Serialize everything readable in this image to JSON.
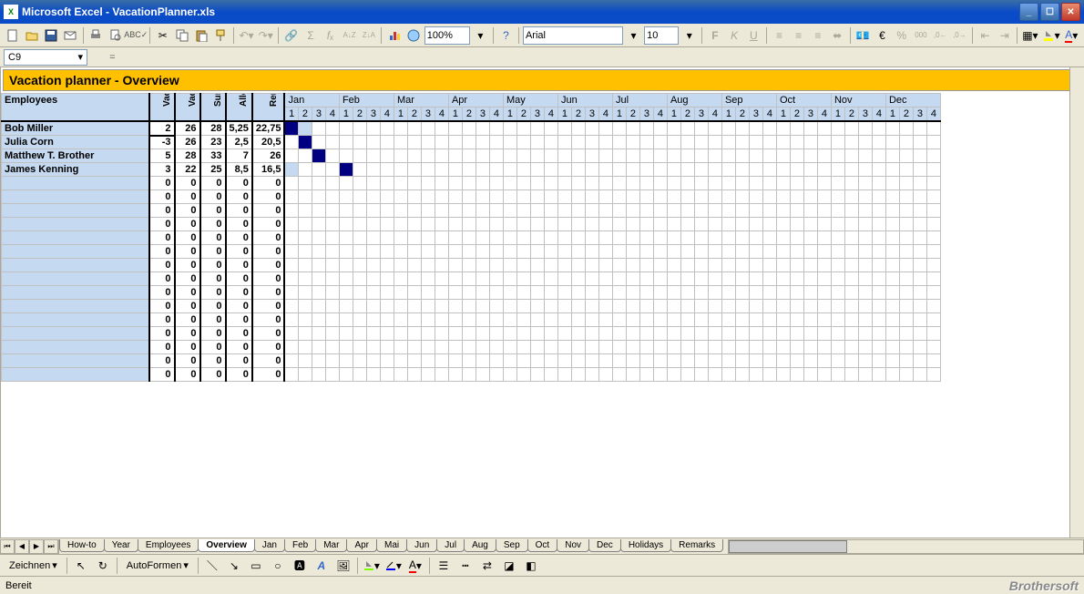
{
  "window": {
    "title": "Microsoft Excel - VacationPlanner.xls"
  },
  "toolbar": {
    "font": "Arial",
    "fontsize": "10",
    "zoom": "100%",
    "bold": "F",
    "italic": "K",
    "underline": "U"
  },
  "formulabar": {
    "namebox": "C9",
    "fx": "="
  },
  "sheet": {
    "title": "Vacation planner - Overview",
    "employees_header": "Employees",
    "col_headers": [
      "Vacation allocation from prior year",
      "Vacation allocation current year",
      "Sum current year",
      "Allocated vacation",
      "Remaing allocation"
    ],
    "months": [
      "Jan",
      "Feb",
      "Mar",
      "Apr",
      "May",
      "Jun",
      "Jul",
      "Aug",
      "Sep",
      "Oct",
      "Nov",
      "Dec"
    ],
    "weeks": [
      "1",
      "2",
      "3",
      "4"
    ],
    "rows": [
      {
        "name": "Bob Miller",
        "v": [
          "2",
          "26",
          "28",
          "5,25",
          "22,75"
        ],
        "cal": {
          "1": "dark",
          "2": "light"
        }
      },
      {
        "name": "Julia Corn",
        "v": [
          "-3",
          "26",
          "23",
          "2,5",
          "20,5"
        ],
        "cal": {
          "2": "dark"
        }
      },
      {
        "name": "Matthew T. Brother",
        "v": [
          "5",
          "28",
          "33",
          "7",
          "26"
        ],
        "cal": {
          "3": "dark"
        }
      },
      {
        "name": "James Kenning",
        "v": [
          "3",
          "22",
          "25",
          "8,5",
          "16,5"
        ],
        "cal": {
          "1": "light",
          "5": "dark"
        }
      },
      {
        "name": "",
        "v": [
          "0",
          "0",
          "0",
          "0",
          "0"
        ]
      },
      {
        "name": "",
        "v": [
          "0",
          "0",
          "0",
          "0",
          "0"
        ]
      },
      {
        "name": "",
        "v": [
          "0",
          "0",
          "0",
          "0",
          "0"
        ]
      },
      {
        "name": "",
        "v": [
          "0",
          "0",
          "0",
          "0",
          "0"
        ]
      },
      {
        "name": "",
        "v": [
          "0",
          "0",
          "0",
          "0",
          "0"
        ]
      },
      {
        "name": "",
        "v": [
          "0",
          "0",
          "0",
          "0",
          "0"
        ]
      },
      {
        "name": "",
        "v": [
          "0",
          "0",
          "0",
          "0",
          "0"
        ]
      },
      {
        "name": "",
        "v": [
          "0",
          "0",
          "0",
          "0",
          "0"
        ]
      },
      {
        "name": "",
        "v": [
          "0",
          "0",
          "0",
          "0",
          "0"
        ]
      },
      {
        "name": "",
        "v": [
          "0",
          "0",
          "0",
          "0",
          "0"
        ]
      },
      {
        "name": "",
        "v": [
          "0",
          "0",
          "0",
          "0",
          "0"
        ]
      },
      {
        "name": "",
        "v": [
          "0",
          "0",
          "0",
          "0",
          "0"
        ]
      },
      {
        "name": "",
        "v": [
          "0",
          "0",
          "0",
          "0",
          "0"
        ]
      },
      {
        "name": "",
        "v": [
          "0",
          "0",
          "0",
          "0",
          "0"
        ]
      },
      {
        "name": "",
        "v": [
          "0",
          "0",
          "0",
          "0",
          "0"
        ]
      }
    ]
  },
  "tabs": {
    "list": [
      "How-to",
      "Year",
      "Employees",
      "Overview",
      "Jan",
      "Feb",
      "Mar",
      "Apr",
      "Mai",
      "Jun",
      "Jul",
      "Aug",
      "Sep",
      "Oct",
      "Nov",
      "Dec",
      "Holidays",
      "Remarks"
    ],
    "active": "Overview"
  },
  "drawing": {
    "zeichnen": "Zeichnen",
    "autoformen": "AutoFormen"
  },
  "status": {
    "ready": "Bereit",
    "brand": "Brothersoft"
  }
}
